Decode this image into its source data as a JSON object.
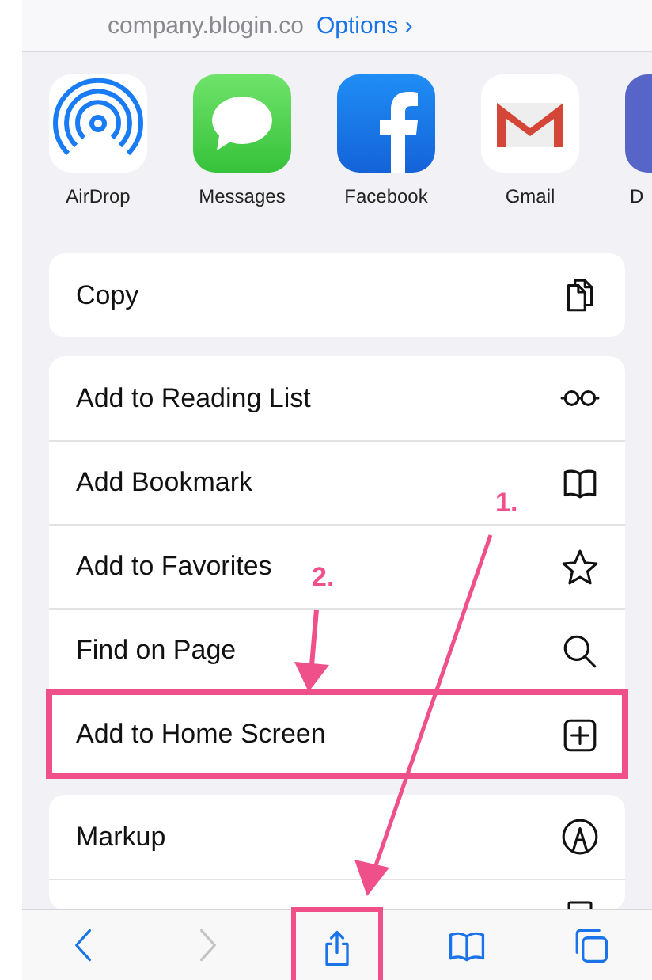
{
  "header": {
    "url": "company.blogin.co",
    "options": "Options ›"
  },
  "apps": [
    {
      "kind": "airdrop",
      "label": "AirDrop"
    },
    {
      "kind": "messages",
      "label": "Messages"
    },
    {
      "kind": "facebook",
      "label": "Facebook"
    },
    {
      "kind": "gmail",
      "label": "Gmail"
    },
    {
      "kind": "discord",
      "label": "D"
    }
  ],
  "action_groups": [
    [
      {
        "label": "Copy",
        "kind": "copy",
        "highlighted": false
      }
    ],
    [
      {
        "label": "Add to Reading List",
        "kind": "glasses",
        "highlighted": false
      },
      {
        "label": "Add Bookmark",
        "kind": "book",
        "highlighted": false
      },
      {
        "label": "Add to Favorites",
        "kind": "star",
        "highlighted": false
      },
      {
        "label": "Find on Page",
        "kind": "search",
        "highlighted": false
      },
      {
        "label": "Add to Home Screen",
        "kind": "plus",
        "highlighted": true
      }
    ],
    [
      {
        "label": "Markup",
        "kind": "markup",
        "highlighted": false
      },
      {
        "kind": "partial",
        "highlighted": false
      }
    ]
  ],
  "toolbar": [
    {
      "kind": "back",
      "disabled": false,
      "highlighted": false
    },
    {
      "kind": "forward",
      "disabled": true,
      "highlighted": false
    },
    {
      "kind": "share",
      "disabled": false,
      "highlighted": true
    },
    {
      "kind": "bookmarks",
      "disabled": false,
      "highlighted": false
    },
    {
      "kind": "tabs",
      "disabled": false,
      "highlighted": false
    }
  ],
  "annotations": [
    {
      "label": "1.",
      "kind": "to-share"
    },
    {
      "label": "2.",
      "kind": "to-home-screen"
    }
  ]
}
